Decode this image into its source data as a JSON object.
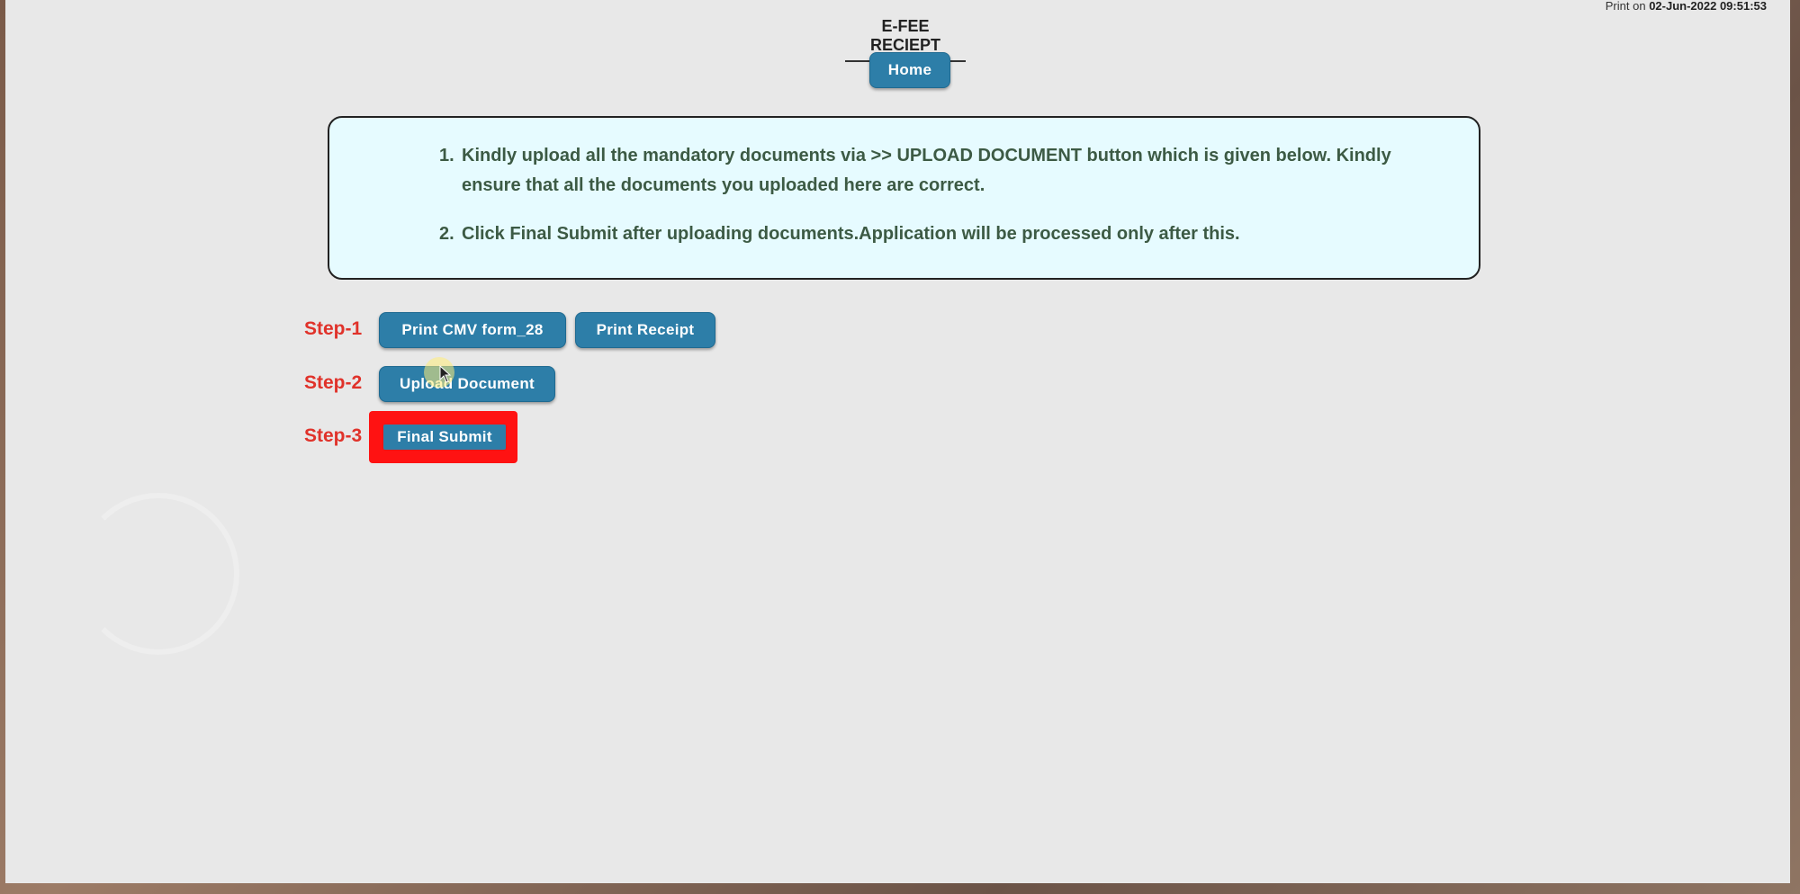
{
  "print_stamp": {
    "prefix": "Print on",
    "datetime": "02-Jun-2022 09:51:53"
  },
  "title": "E-FEE RECIEPT",
  "home_button": "Home",
  "instructions": [
    {
      "num": "1.",
      "text": "Kindly upload all the mandatory documents via >> UPLOAD DOCUMENT button which is given below. Kindly ensure that all the documents you uploaded here are correct."
    },
    {
      "num": "2.",
      "text": "Click Final Submit after uploading documents.Application will be processed only after this."
    }
  ],
  "steps": {
    "step1": {
      "label": "Step-1",
      "buttons": [
        "Print CMV form_28",
        "Print Receipt"
      ]
    },
    "step2": {
      "label": "Step-2",
      "buttons": [
        "Upload Document"
      ]
    },
    "step3": {
      "label": "Step-3",
      "buttons": [
        "Final Submit"
      ]
    }
  },
  "colors": {
    "button_bg": "#2d7ea8",
    "step_label": "#e0322a",
    "highlight": "#ff1212",
    "notice_bg": "#e6fbff",
    "notice_text": "#3c5a44"
  }
}
